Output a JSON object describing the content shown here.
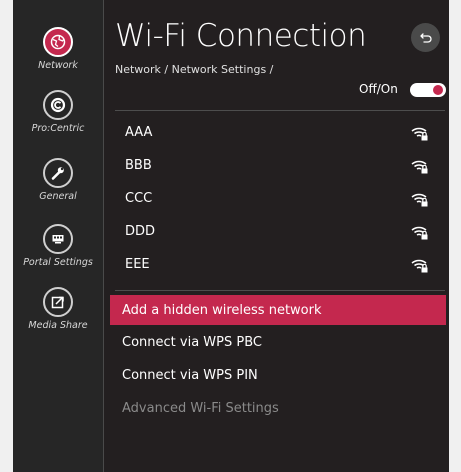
{
  "sidebar": {
    "items": [
      {
        "label": "Network",
        "icon": "globe-icon",
        "active": true
      },
      {
        "label": "Pro:Centric",
        "icon": "procentric-icon",
        "active": false
      },
      {
        "label": "General",
        "icon": "wrench-icon",
        "active": false
      },
      {
        "label": "Portal Settings",
        "icon": "portal-icon",
        "active": false
      },
      {
        "label": "Media Share",
        "icon": "share-icon",
        "active": false
      }
    ]
  },
  "header": {
    "title": "Wi-Fi Connection",
    "breadcrumb": "Network / Network Settings /",
    "back_icon": "back-icon"
  },
  "wifi_toggle": {
    "label": "Off/On",
    "state": "on"
  },
  "networks": [
    {
      "name": "AAA",
      "icon": "wifi-locked-icon"
    },
    {
      "name": "BBB",
      "icon": "wifi-locked-icon"
    },
    {
      "name": "CCC",
      "icon": "wifi-locked-icon"
    },
    {
      "name": "DDD",
      "icon": "wifi-locked-icon"
    },
    {
      "name": "EEE",
      "icon": "wifi-locked-icon"
    }
  ],
  "actions": [
    {
      "label": "Add a hidden wireless network",
      "highlighted": true
    },
    {
      "label": "Connect via WPS PBC"
    },
    {
      "label": "Connect via WPS PIN"
    },
    {
      "label": "Advanced Wi-Fi Settings",
      "disabled": true
    }
  ],
  "colors": {
    "accent": "#c4284e",
    "background": "#231f20",
    "sidebar": "#262626",
    "text": "#ffffff",
    "disabled_text": "#8a8a8a"
  }
}
